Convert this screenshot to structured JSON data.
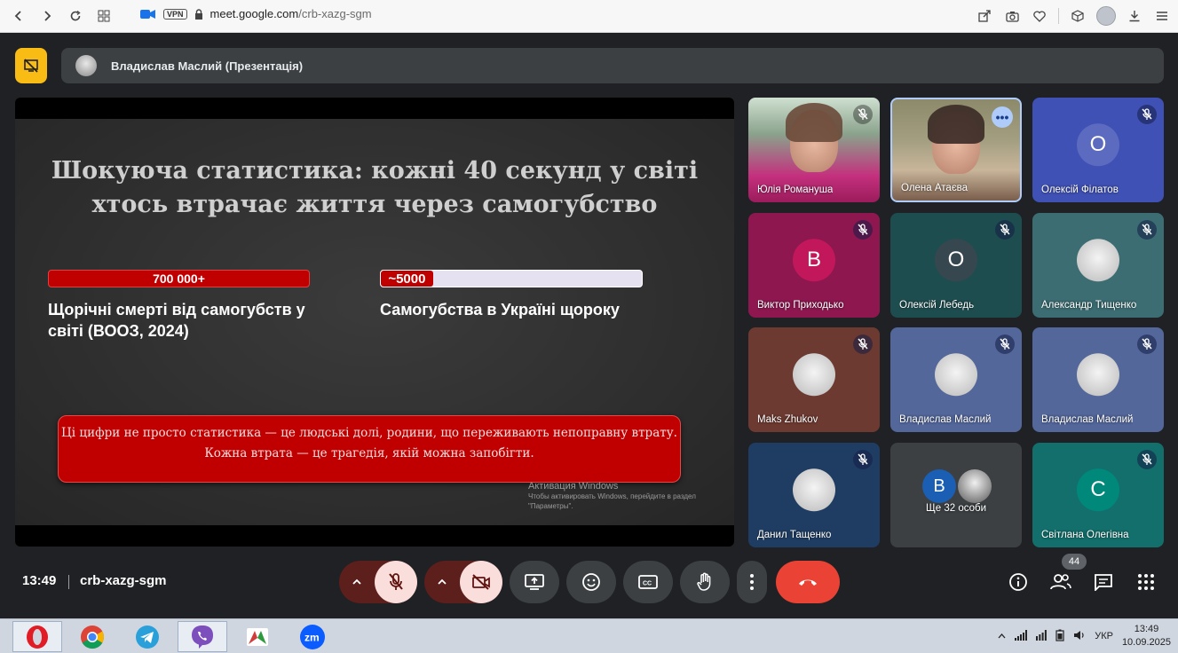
{
  "browser": {
    "url_host": "meet.google.com",
    "url_path": "/crb-xazg-sgm",
    "vpn": "VPN"
  },
  "header": {
    "presenter": "Владислав Маслий (Презентація)"
  },
  "slide": {
    "title_line1": "Шокуюча статистика: кожні 40 секунд у світі",
    "title_line2": "хтось втрачає життя через самогубство",
    "stat1": {
      "value": "700 000+",
      "caption": "Щорічні смерті від самогубств у світі (ВООЗ, 2024)",
      "fill": 1.0
    },
    "stat2": {
      "value": "~5000",
      "caption": "Самогубства в Україні щороку",
      "fill": 0.2
    },
    "quote_line1": "Ці цифри не просто статистика — це людські долі, родини, що переживають непоправну втрату.",
    "quote_line2": "Кожна втрата — це трагедія, якій можна запобігти.",
    "watermark_title": "Активация Windows",
    "watermark_text": "Чтобы активировать Windows, перейдите в раздел \"Параметры\"."
  },
  "participants": [
    {
      "name": "Юлія Романуша",
      "type": "video",
      "muted": true
    },
    {
      "name": "Олена Атаєва",
      "type": "video",
      "muted": false,
      "menu": true
    },
    {
      "name": "Олексій Філатов",
      "type": "initial",
      "initial": "О",
      "muted": true,
      "bg": "#3f51b5",
      "circle": "#5c6bc0"
    },
    {
      "name": "Виктор Приходько",
      "type": "initial",
      "initial": "В",
      "muted": true,
      "bg": "#8e1750",
      "circle": "#c2185b"
    },
    {
      "name": "Олексій Лебедь",
      "type": "initial",
      "initial": "О",
      "muted": true,
      "bg": "#1e4d4f",
      "circle": "#37474f"
    },
    {
      "name": "Александр Тищенко",
      "type": "photo",
      "muted": true,
      "bg": "#3b6d73"
    },
    {
      "name": "Maks Zhukov",
      "type": "photo",
      "muted": true,
      "bg": "#6d3a31"
    },
    {
      "name": "Владислав Маслий",
      "type": "photo",
      "muted": true,
      "bg": "#53679b"
    },
    {
      "name": "Владислав Маслий",
      "type": "photo",
      "muted": true,
      "bg": "#53679b"
    },
    {
      "name": "Данил Тащенко",
      "type": "photo",
      "muted": true,
      "bg": "#1f3d63"
    },
    {
      "name": "Ще 32 особи",
      "type": "group",
      "initial": "В"
    },
    {
      "name": "Світлана Олегівна",
      "type": "initial",
      "initial": "С",
      "muted": true,
      "bg": "#136f6b",
      "circle": "#00897b"
    }
  ],
  "controls": {
    "time": "13:49",
    "meeting_code": "crb-xazg-sgm",
    "participants_count": "44"
  },
  "taskbar": {
    "language": "УКР",
    "clock_time": "13:49",
    "clock_date": "10.09.2025"
  },
  "colors": {
    "accent_red": "#c00000",
    "end_call": "#ea4335",
    "present_yellow": "#f9bc15"
  }
}
